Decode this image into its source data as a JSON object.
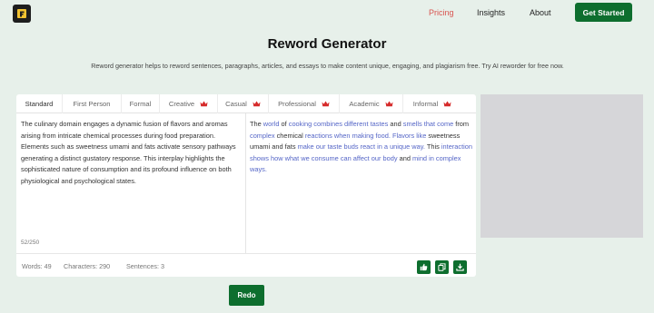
{
  "nav": {
    "items": [
      "Pricing",
      "Insights",
      "About"
    ],
    "cta": "Get Started",
    "active_color": "#d9534f"
  },
  "header": {
    "title": "Reword Generator",
    "subtitle": "Reword generator helps to reword sentences, paragraphs, articles, and essays to make content unique, engaging, and plagiarism free. Try AI reworder for free now."
  },
  "tabs": [
    {
      "label": "Standard",
      "premium": false,
      "active": true
    },
    {
      "label": "First Person",
      "premium": false
    },
    {
      "label": "Formal",
      "premium": false
    },
    {
      "label": "Creative",
      "premium": true
    },
    {
      "label": "Casual",
      "premium": true
    },
    {
      "label": "Professional",
      "premium": true
    },
    {
      "label": "Academic",
      "premium": true
    },
    {
      "label": "Informal",
      "premium": true
    }
  ],
  "input": {
    "text": "The culinary domain engages a dynamic fusion of flavors and aromas arising from intricate chemical processes during food preparation. Elements such as sweetness umami and fats activate sensory pathways generating a distinct gustatory response. This interplay highlights the sophisticated nature of consumption and its profound influence on both physiological and psychological states.",
    "word_counter": "52/250"
  },
  "output": {
    "segments": [
      {
        "t": "The ",
        "c": false
      },
      {
        "t": "world",
        "c": true
      },
      {
        "t": " of ",
        "c": false
      },
      {
        "t": "cooking combines different tastes",
        "c": true
      },
      {
        "t": " and ",
        "c": false
      },
      {
        "t": "smells that come",
        "c": true
      },
      {
        "t": " from ",
        "c": false
      },
      {
        "t": "complex",
        "c": true
      },
      {
        "t": " chemical ",
        "c": false
      },
      {
        "t": "reactions when making food. Flavors like",
        "c": true
      },
      {
        "t": " sweetness umami and fats ",
        "c": false
      },
      {
        "t": "make our taste buds react in a unique way.",
        "c": true
      },
      {
        "t": " This ",
        "c": false
      },
      {
        "t": "interaction shows how what we consume can affect our body",
        "c": true
      },
      {
        "t": " and ",
        "c": false
      },
      {
        "t": "mind in complex ways.",
        "c": true
      }
    ]
  },
  "stats": {
    "words": "Words: 49",
    "characters": "Characters: 290",
    "sentences": "Sentences: 3"
  },
  "actions": {
    "icons": [
      "thumbs-up-icon",
      "copy-icon",
      "download-icon"
    ],
    "redo": "Redo"
  },
  "colors": {
    "brand": "#0d6e2e",
    "changed_word": "#5566c7",
    "background": "#e7f0ea",
    "premium_crown": "#d62b2b"
  }
}
